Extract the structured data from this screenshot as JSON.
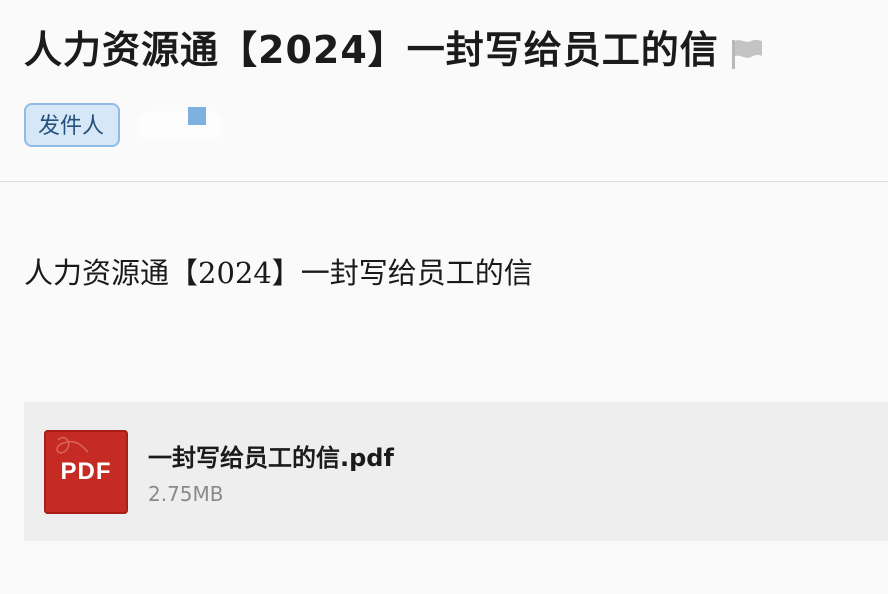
{
  "email": {
    "subject": "人力资源通【2024】一封写给员工的信",
    "sender_label": "发件人",
    "body_text": "人力资源通【2024】一封写给员工的信"
  },
  "attachment": {
    "file_name": "一封写给员工的信.pdf",
    "file_size": "2.75MB",
    "file_type_label": "PDF",
    "icon": "pdf-file-icon"
  },
  "icons": {
    "flag": "flag-icon"
  },
  "colors": {
    "sender_tag_bg": "#d6e8f8",
    "sender_tag_border": "#8fbbe4",
    "pdf_red": "#c52b22",
    "attachment_bg": "#eeeeee"
  }
}
